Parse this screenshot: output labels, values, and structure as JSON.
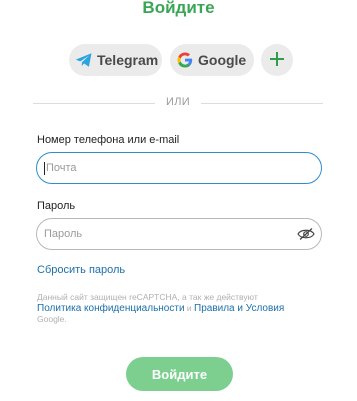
{
  "title": "Войдите",
  "social": {
    "telegram_label": "Telegram",
    "google_label": "Google",
    "more_label": "+"
  },
  "divider_text": "ИЛИ",
  "login": {
    "label": "Номер телефона или e-mail",
    "value": "",
    "placeholder": "Почта"
  },
  "password": {
    "label": "Пароль",
    "value": "",
    "placeholder": "Пароль"
  },
  "reset_link": "Сбросить пароль",
  "recaptcha": {
    "text_before": "Данный сайт защищен reCAPTCHA, а так же действуют",
    "privacy_link": "Политика конфиденциальности",
    "and": " и ",
    "terms_link": "Правила и Условия",
    "text_after": "Google."
  },
  "submit_label": "Войдите",
  "colors": {
    "title_green": "#3aa655",
    "submit_green": "#7ccf8f",
    "link_blue": "#1c6fa9",
    "focus_blue": "#2e8dcc",
    "telegram_blue": "#2aa3df",
    "plus_green": "#2e9e4a"
  },
  "icons": {
    "telegram": "telegram-icon",
    "google": "google-icon",
    "plus": "plus-icon",
    "eye": "eye-icon"
  }
}
